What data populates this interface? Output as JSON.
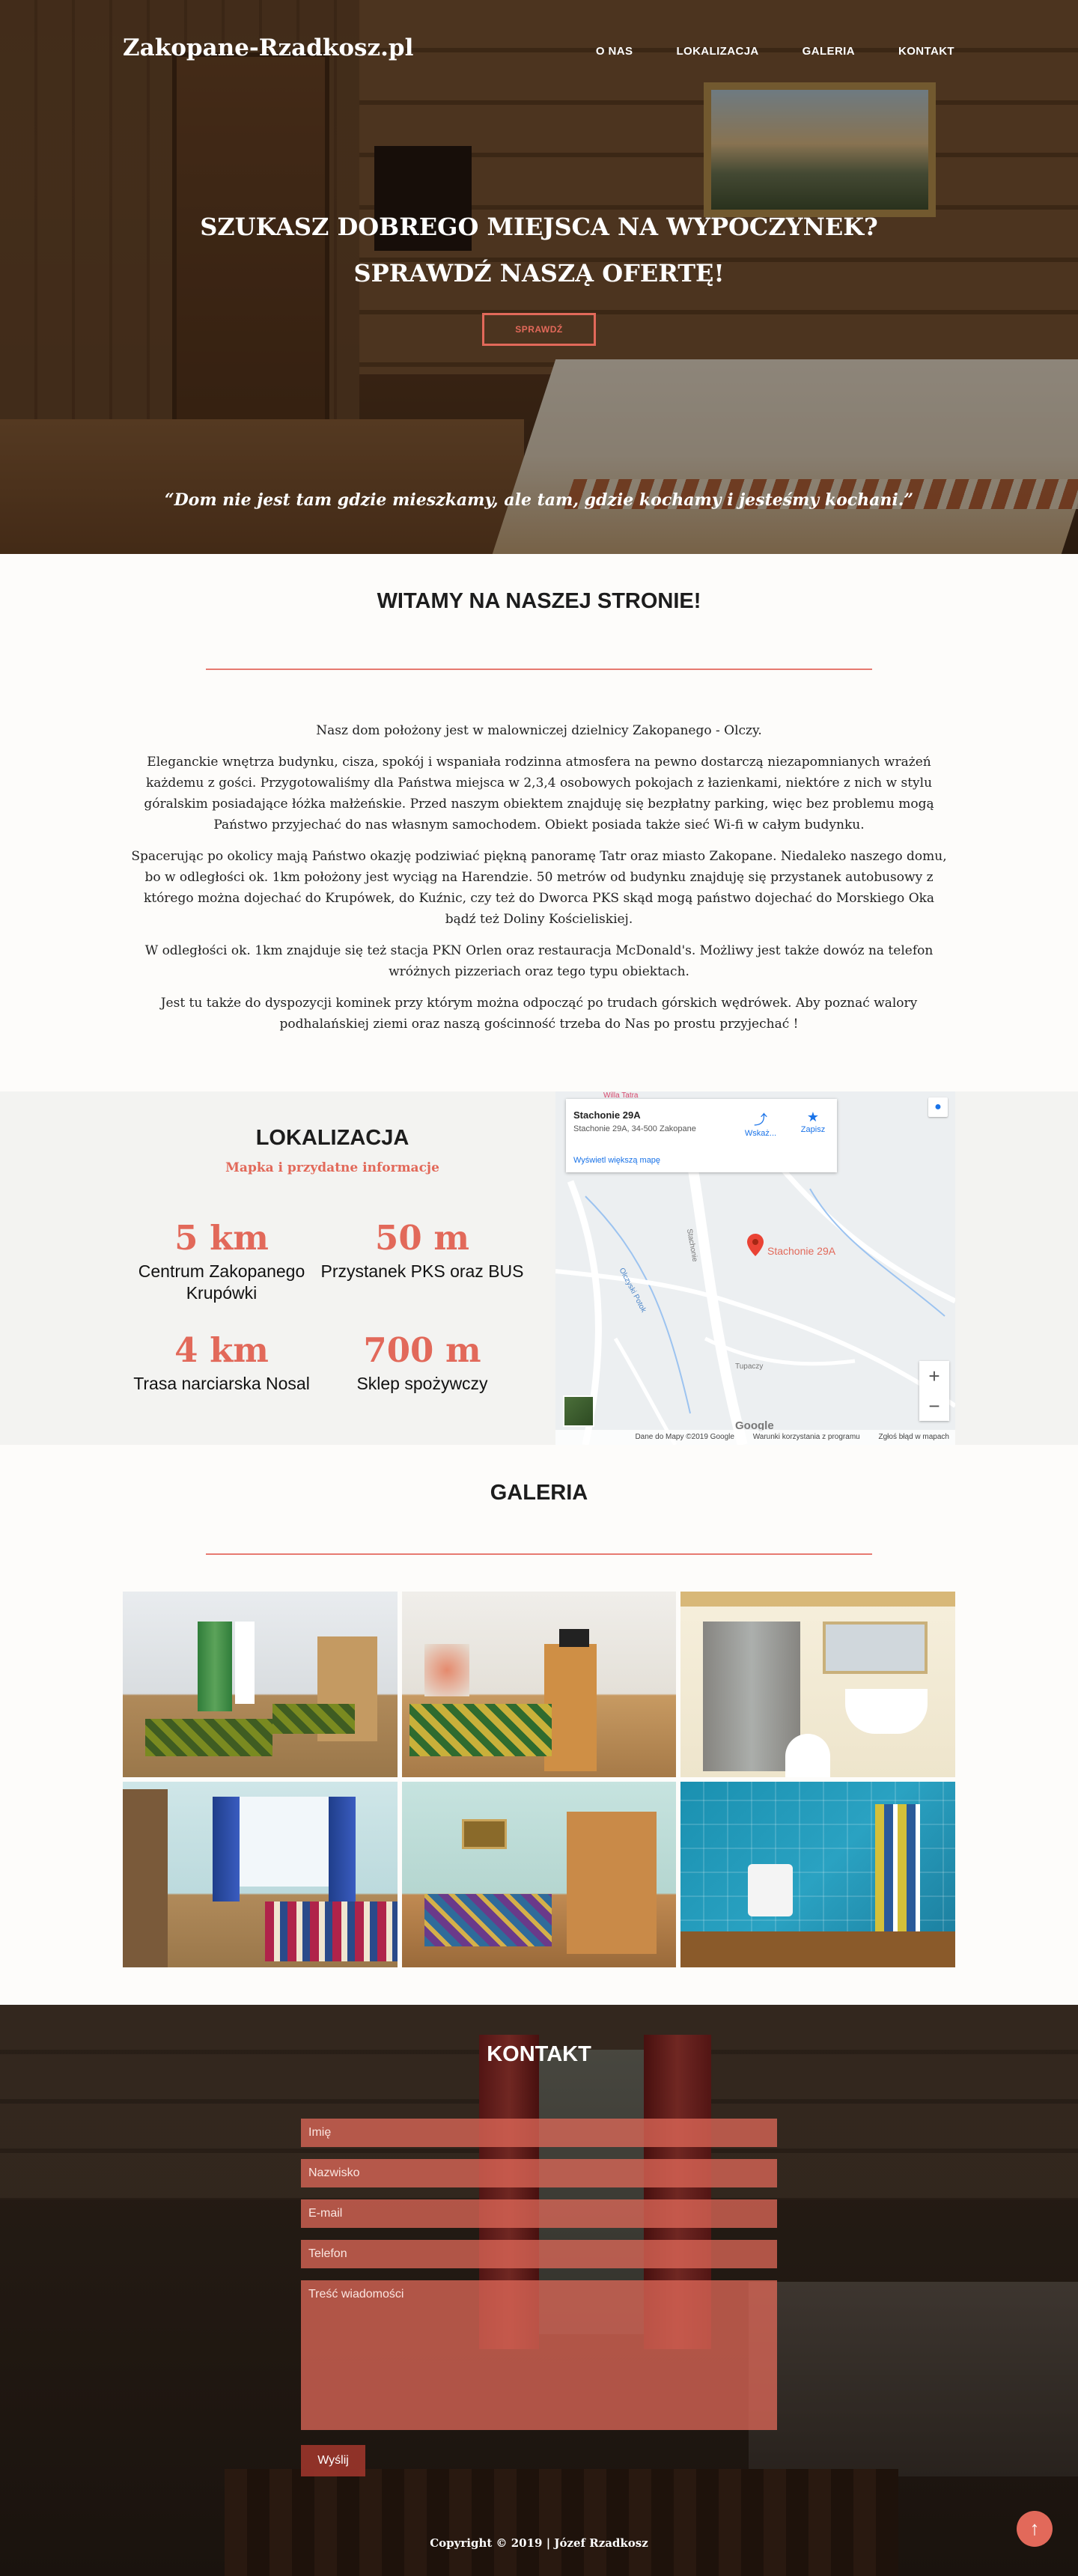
{
  "nav": {
    "brand": "Zakopane-Rzadkosz.pl",
    "items": [
      "O NAS",
      "LOKALIZACJA",
      "GALERIA",
      "KONTAKT"
    ]
  },
  "hero": {
    "line1": "SZUKASZ DOBREGO MIEJSCA NA WYPOCZYNEK?",
    "line2": "SPRAWDŹ NASZĄ OFERTĘ!",
    "button": "SPRAWDŹ",
    "quote": "“Dom nie jest tam gdzie mieszkamy, ale tam, gdzie kochamy i jesteśmy kochani.”"
  },
  "welcome": {
    "title": "WITAMY NA NASZEJ STRONIE!",
    "paragraphs": [
      "Nasz dom położony jest w malowniczej dzielnicy Zakopanego - Olczy.",
      "Eleganckie wnętrza budynku, cisza, spokój i wspaniała rodzinna atmosfera na pewno dostarczą niezapomnianych wrażeń każdemu z gości. Przygotowaliśmy dla Państwa miejsca w 2,3,4 osobowych pokojach z łazienkami, niektóre z nich w stylu góralskim posiadające łóżka małżeńskie. Przed naszym obiektem znajduję się bezpłatny parking, więc bez problemu mogą Państwo przyjechać do nas własnym samochodem. Obiekt posiada także sieć Wi-fi w całym budynku.",
      "Spacerując po okolicy mają Państwo okazję podziwiać piękną panoramę Tatr oraz miasto Zakopane. Niedaleko naszego domu, bo w odległości ok. 1km położony jest wyciąg na Harendzie. 50 metrów od budynku znajduję się przystanek autobusowy z którego można dojechać do Krupówek, do Kuźnic, czy też do Dworca PKS skąd mogą państwo dojechać do Morskiego Oka bądź też Doliny Kościeliskiej.",
      "W odległości ok. 1km znajduje się też stacja PKN Orlen oraz restauracja McDonald's. Możliwy jest także dowóz na telefon wróżnych pizzeriach oraz tego typu obiektach.",
      "Jest tu także do dyspozycji kominek przy którym można odpocząć po trudach górskich wędrówek. Aby poznać walory podhalańskiej ziemi oraz naszą gościnność trzeba do Nas po prostu przyjechać !"
    ]
  },
  "location": {
    "title": "LOKALIZACJA",
    "subtitle": "Mapka i przydatne informacje",
    "stats": [
      {
        "value": "5 km",
        "label": "Centrum Zakopanego Krupówki"
      },
      {
        "value": "50 m",
        "label": "Przystanek PKS oraz BUS"
      },
      {
        "value": "4 km",
        "label": "Trasa narciarska Nosal"
      },
      {
        "value": "700 m",
        "label": "Sklep spożywczy"
      }
    ],
    "map": {
      "place": "Stachonie 29A",
      "address": "Stachonie 29A, 34-500 Zakopane",
      "directions": "Wskaż...",
      "save": "Zapisz",
      "bigger_map": "Wyświetl większą mapę",
      "pin_label": "Stachonie 29A",
      "top_place": "Willa Tatra",
      "zoom_in": "+",
      "zoom_out": "−",
      "footer": [
        "Dane do Mapy ©2019 Google",
        "Warunki korzystania z programu",
        "Zgłoś błąd w mapach"
      ],
      "logo": "Google",
      "streets": [
        "Olczyski Potok",
        "Stachonie",
        "Tupaczy"
      ]
    }
  },
  "gallery": {
    "title": "GALERIA"
  },
  "contact": {
    "title": "KONTAKT",
    "fields": {
      "name": "Imię",
      "surname": "Nazwisko",
      "email": "E-mail",
      "phone": "Telefon",
      "message": "Treść wiadomości"
    },
    "send": "Wyślij"
  },
  "footer": {
    "copyright": "Copyright © 2019 | Józef Rzadkosz"
  },
  "colors": {
    "accent": "#e2695a",
    "divider": "#e77a70"
  },
  "icons": {
    "back_to_top": "arrow-up-circle-icon"
  }
}
